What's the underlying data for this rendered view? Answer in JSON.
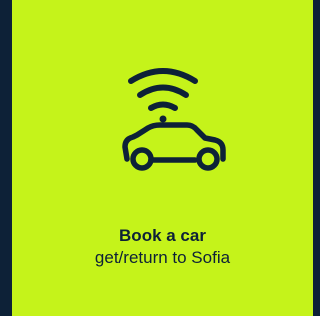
{
  "card": {
    "title": "Book a car",
    "subtitle": "get/return to Sofia",
    "icon": "connected-car-icon"
  },
  "colors": {
    "tile_background": "#c5f31a",
    "page_background": "#0d2137",
    "text": "#0d2137"
  }
}
